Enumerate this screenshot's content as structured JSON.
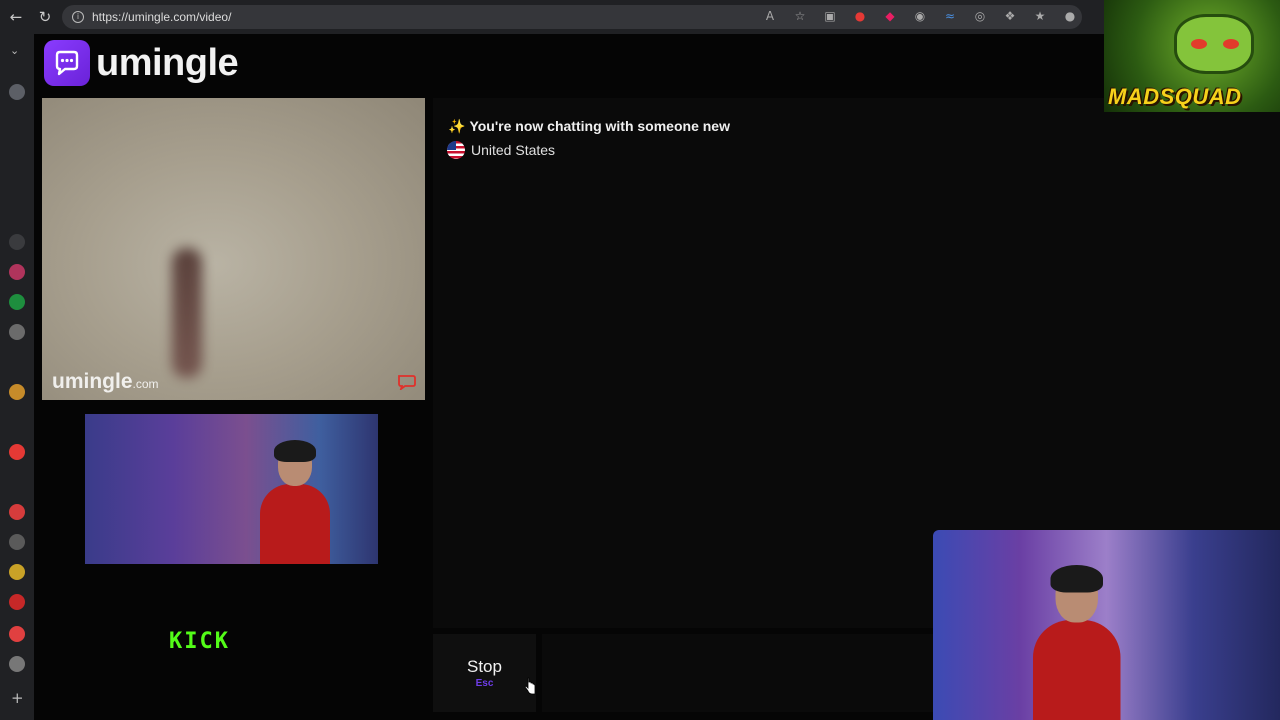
{
  "browser": {
    "url": "https://umingle.com/video/",
    "back_icon": "arrow-left-icon",
    "reload_icon": "reload-icon"
  },
  "site": {
    "logo_text": "umingle",
    "brand_color": "#7b2ff7"
  },
  "remote_video": {
    "watermark": "umingle",
    "watermark_suffix": ".com",
    "report_icon": "report-flag-icon"
  },
  "chat": {
    "system_message": "You're now chatting with someone new",
    "country": "United States"
  },
  "controls": {
    "stop_label": "Stop",
    "stop_key": "Esc",
    "message_placeholder": ""
  },
  "overlays": {
    "kick_logo": "KICK",
    "channel_logo_text": "MADSQUAD"
  }
}
